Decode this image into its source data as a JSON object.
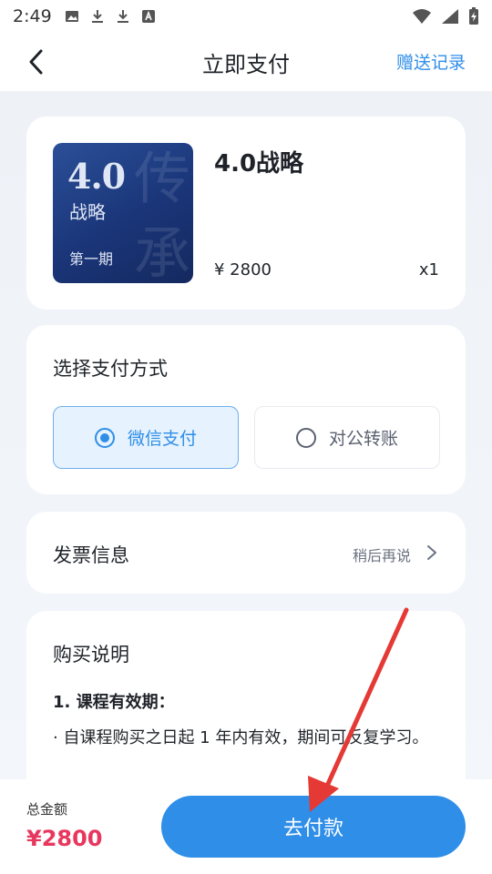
{
  "status_bar": {
    "time": "2:49",
    "left_icons": [
      "image-icon",
      "download-icon",
      "download-icon",
      "a-box-icon"
    ],
    "right_icons": [
      "wifi-icon",
      "signal-icon",
      "battery-charging-icon"
    ]
  },
  "header": {
    "title": "立即支付",
    "right_link": "赠送记录"
  },
  "product": {
    "cover_big": "4.0",
    "cover_sub": "战略",
    "cover_issue": "第一期",
    "cover_deco": "传 承",
    "name": "4.0战略",
    "price": "¥ 2800",
    "quantity": "x1"
  },
  "payment": {
    "title": "选择支付方式",
    "options": [
      {
        "label": "微信支付",
        "selected": true
      },
      {
        "label": "对公转账",
        "selected": false
      }
    ]
  },
  "invoice": {
    "title": "发票信息",
    "value": "稍后再说"
  },
  "note": {
    "title": "购买说明",
    "heading": "1. 课程有效期：",
    "body": "· 自课程购买之日起 1 年内有效，期间可反复学习。"
  },
  "footer": {
    "total_label": "总金额",
    "total_amount": "¥2800",
    "pay_button": "去付款"
  },
  "colors": {
    "accent": "#2f8ee8",
    "price_red": "#e8375e",
    "annotation": "#e53935"
  }
}
